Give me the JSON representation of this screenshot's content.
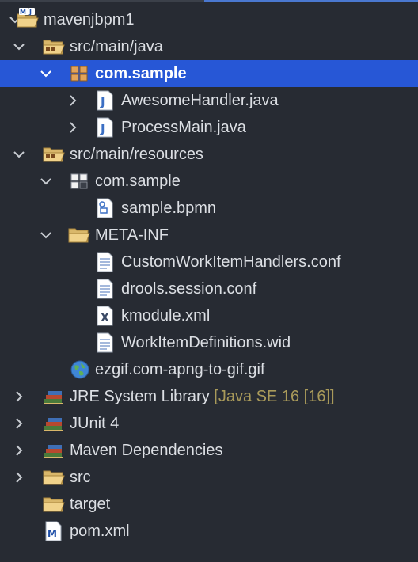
{
  "tree": {
    "project": {
      "label": "mavenjbpm1",
      "icon": "maven-project-icon"
    },
    "src_main_java": {
      "label": "src/main/java",
      "icon": "source-folder-icon"
    },
    "pkg_com_sample": {
      "label": "com.sample",
      "icon": "package-icon",
      "selected": true
    },
    "awesome_handler": {
      "label": "AwesomeHandler.java",
      "icon": "java-file-icon"
    },
    "process_main": {
      "label": "ProcessMain.java",
      "icon": "java-file-icon"
    },
    "src_main_resources": {
      "label": "src/main/resources",
      "icon": "source-folder-icon"
    },
    "res_com_sample": {
      "label": "com.sample",
      "icon": "package-icon"
    },
    "sample_bpmn": {
      "label": "sample.bpmn",
      "icon": "bpmn-file-icon"
    },
    "meta_inf": {
      "label": "META-INF",
      "icon": "folder-icon"
    },
    "custom_handlers": {
      "label": "CustomWorkItemHandlers.conf",
      "icon": "text-file-icon"
    },
    "drools_session": {
      "label": "drools.session.conf",
      "icon": "text-file-icon"
    },
    "kmodule": {
      "label": "kmodule.xml",
      "icon": "xml-file-icon"
    },
    "workitem_defs": {
      "label": "WorkItemDefinitions.wid",
      "icon": "text-file-icon"
    },
    "ezgif": {
      "label": "ezgif.com-apng-to-gif.gif",
      "icon": "globe-icon"
    },
    "jre_library": {
      "label": "JRE System Library",
      "decoration": "[Java SE 16 [16]]",
      "icon": "library-icon"
    },
    "junit": {
      "label": "JUnit 4",
      "icon": "library-icon"
    },
    "maven_deps": {
      "label": "Maven Dependencies",
      "icon": "library-icon"
    },
    "src": {
      "label": "src",
      "icon": "folder-icon"
    },
    "target": {
      "label": "target",
      "icon": "folder-icon"
    },
    "pom": {
      "label": "pom.xml",
      "icon": "maven-pom-icon"
    }
  },
  "colors": {
    "background": "#272b33",
    "selection": "#2757d6",
    "text": "#dcdfe4",
    "decoration": "#a99a5a",
    "folder": "#d9b76a"
  }
}
